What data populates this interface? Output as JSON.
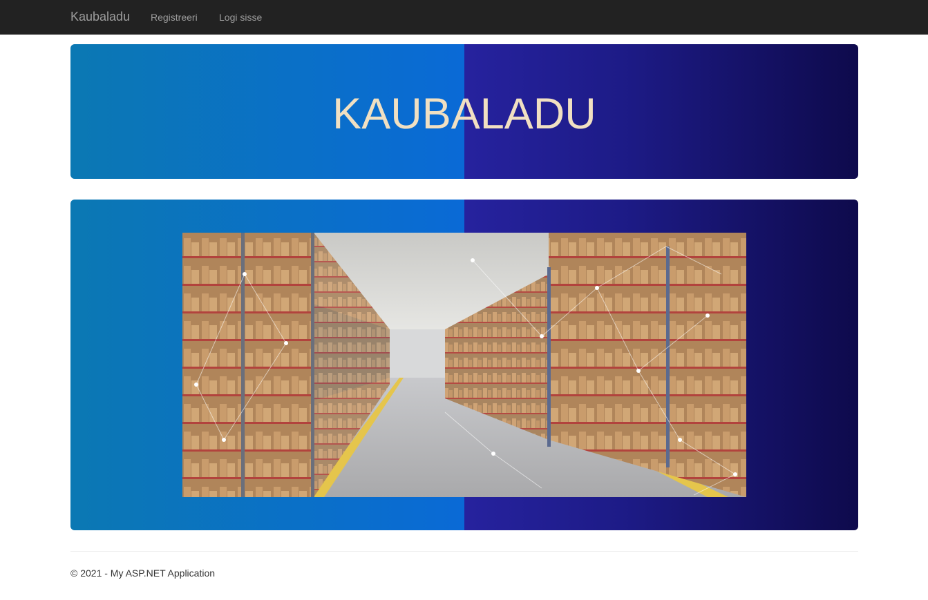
{
  "navbar": {
    "brand": "Kaubaladu",
    "links": [
      {
        "label": "Registreeri"
      },
      {
        "label": "Logi sisse"
      }
    ]
  },
  "banner": {
    "title": "KAUBALADU"
  },
  "hero": {
    "image": "warehouse-shelves-photo"
  },
  "footer": {
    "text": "© 2021 - My ASP.NET Application"
  },
  "colors": {
    "navbar_bg": "#222222",
    "nav_text": "#9d9d9d",
    "title_text": "#f1e0c2",
    "gradient_left_start": "#0b78b3",
    "gradient_left_end": "#0a6ad6",
    "gradient_right_start": "#26229e",
    "gradient_right_end": "#0e0a4c"
  }
}
